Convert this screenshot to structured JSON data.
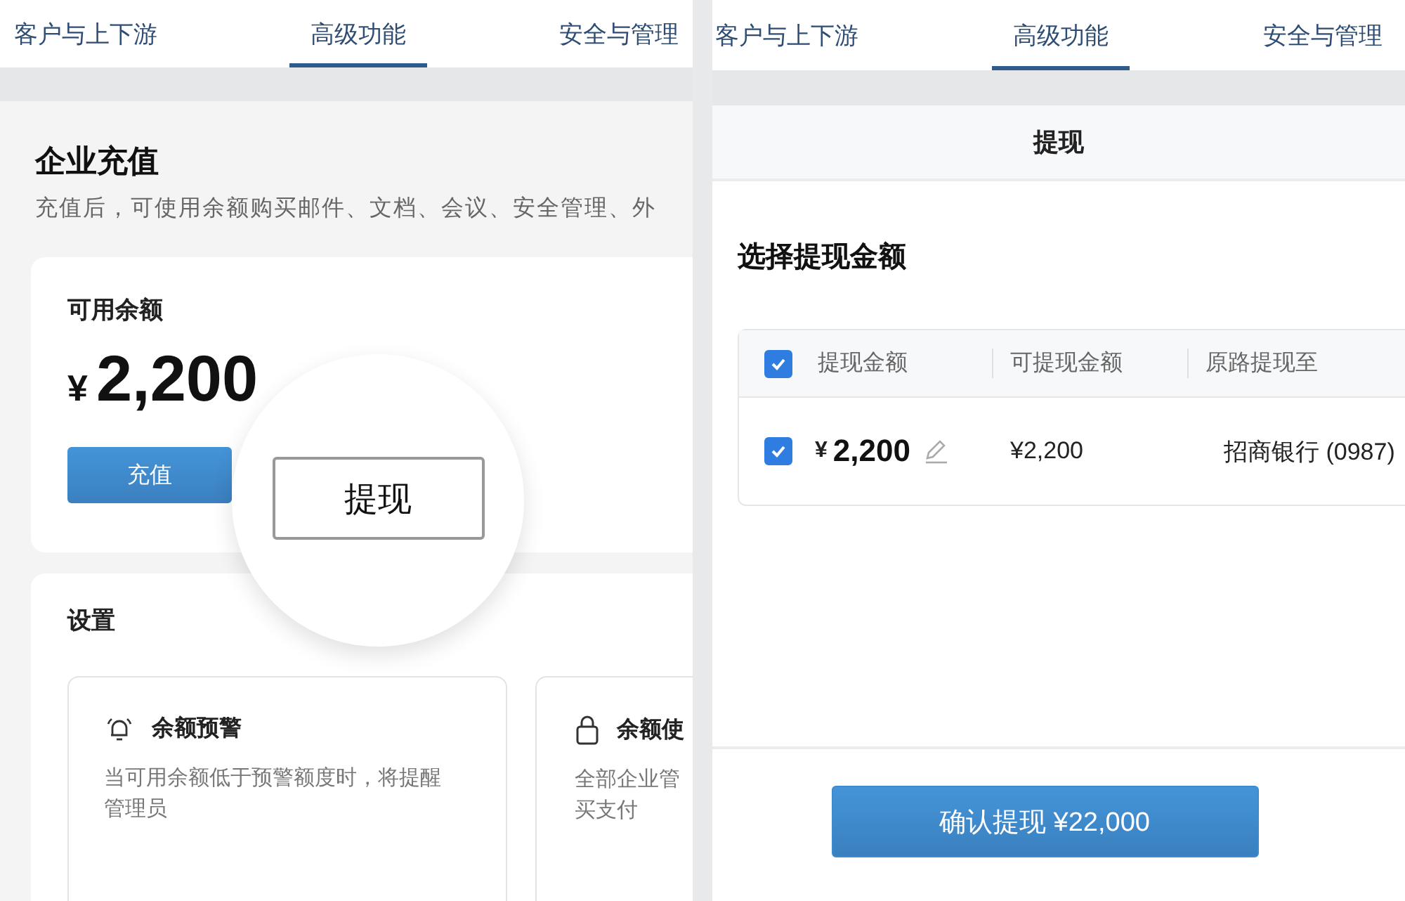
{
  "left_screen": {
    "tabs": [
      {
        "label": "客户与上下游",
        "selected": false
      },
      {
        "label": "高级功能",
        "selected": true
      },
      {
        "label": "安全与管理",
        "selected": false
      }
    ],
    "title": "企业充值",
    "subtitle": "充值后，可使用余额购买邮件、文档、会议、安全管理、外",
    "balance": {
      "label": "可用余额",
      "currency": "¥",
      "amount": "2,200",
      "recharge_button": "充值"
    },
    "magnifier": {
      "button": "提现"
    },
    "settings": {
      "title": "设置",
      "cards": [
        {
          "kind": "alert",
          "title": "余额预警",
          "description": "当可用余额低于预警额度时，将提醒管理员"
        },
        {
          "kind": "lock",
          "title": "余额使",
          "description": "全部企业管买支付"
        }
      ]
    }
  },
  "right_screen": {
    "tabs": [
      {
        "label": "客户与上下游",
        "selected": false
      },
      {
        "label": "高级功能",
        "selected": true
      },
      {
        "label": "安全与管理",
        "selected": false
      }
    ],
    "sheet_title": "提现",
    "heading": "选择提现金额",
    "table": {
      "all_checked": true,
      "columns": [
        "提现金额",
        "可提现金额",
        "原路提现至"
      ],
      "rows": [
        {
          "checked": true,
          "currency": "¥",
          "amount": "2,200",
          "available": "¥2,200",
          "destination": "招商银行 (0987)"
        }
      ]
    },
    "confirm_button": "确认提现 ¥22,000"
  }
}
